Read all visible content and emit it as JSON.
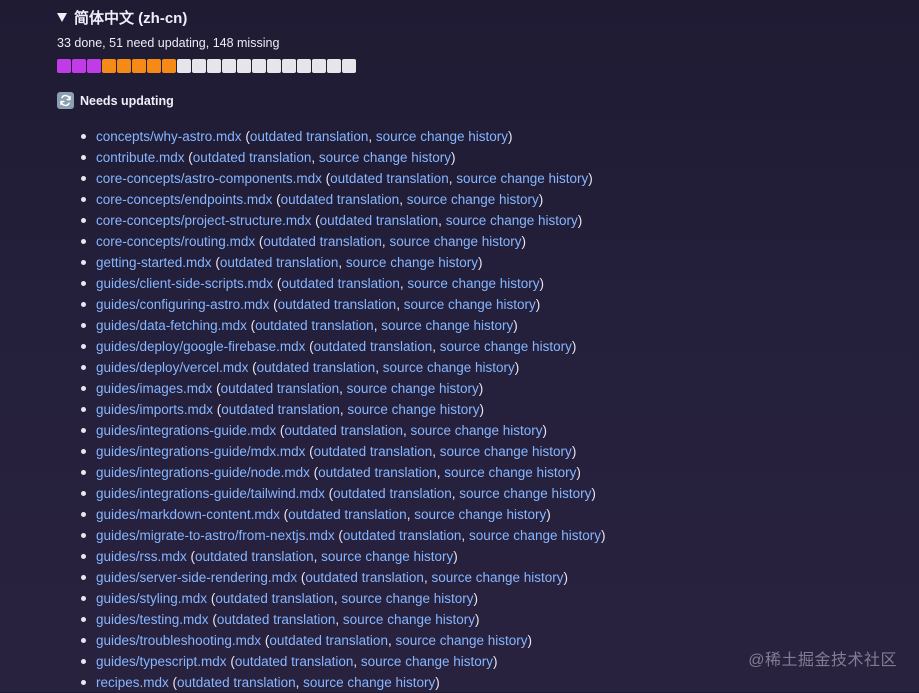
{
  "section": {
    "title": "简体中文 (zh-cn)",
    "stats": "33 done, 51 need updating, 148 missing",
    "progress": {
      "done_blocks": 3,
      "outdated_blocks": 5,
      "missing_blocks": 12
    },
    "colors": {
      "done": "#c13ce6",
      "outdated": "#f58b16",
      "missing": "#e6e6ea",
      "link": "#86b6ff"
    }
  },
  "needs_updating": {
    "heading": "Needs updating",
    "icon": "refresh-icon",
    "link_labels": {
      "outdated": "outdated translation",
      "history": "source change history"
    },
    "files": [
      "concepts/why-astro.mdx",
      "contribute.mdx",
      "core-concepts/astro-components.mdx",
      "core-concepts/endpoints.mdx",
      "core-concepts/project-structure.mdx",
      "core-concepts/routing.mdx",
      "getting-started.mdx",
      "guides/client-side-scripts.mdx",
      "guides/configuring-astro.mdx",
      "guides/data-fetching.mdx",
      "guides/deploy/google-firebase.mdx",
      "guides/deploy/vercel.mdx",
      "guides/images.mdx",
      "guides/imports.mdx",
      "guides/integrations-guide.mdx",
      "guides/integrations-guide/mdx.mdx",
      "guides/integrations-guide/node.mdx",
      "guides/integrations-guide/tailwind.mdx",
      "guides/markdown-content.mdx",
      "guides/migrate-to-astro/from-nextjs.mdx",
      "guides/rss.mdx",
      "guides/server-side-rendering.mdx",
      "guides/styling.mdx",
      "guides/testing.mdx",
      "guides/troubleshooting.mdx",
      "guides/typescript.mdx",
      "recipes.mdx"
    ]
  },
  "watermark": "@稀土掘金技术社区"
}
